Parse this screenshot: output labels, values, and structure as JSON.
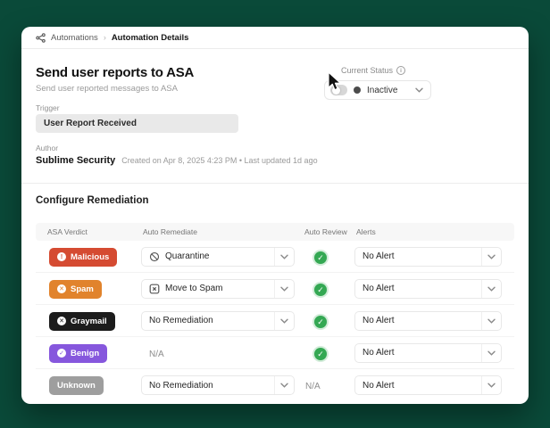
{
  "colors": {
    "malicious": "#d54b32",
    "spam": "#e1832c",
    "graymail": "#1c1c1c",
    "benign": "#8657dd",
    "unknown": "#9e9e9e",
    "check_green": "#34a853",
    "status_dot": "#4c4c4c"
  },
  "breadcrumb": {
    "items": [
      {
        "label": "Automations"
      },
      {
        "label": "Automation Details"
      }
    ]
  },
  "header": {
    "title": "Send user reports to ASA",
    "subtitle": "Send user reported messages to ASA"
  },
  "status": {
    "label": "Current Status",
    "value": "Inactive"
  },
  "trigger": {
    "label": "Trigger",
    "value": "User Report Received"
  },
  "author": {
    "label": "Author",
    "name": "Sublime Security",
    "meta": "Created on Apr 8, 2025 4:23 PM • Last updated 1d ago"
  },
  "remediation": {
    "title": "Configure Remediation",
    "columns": [
      "ASA Verdict",
      "Auto Remediate",
      "Auto Review",
      "Alerts"
    ],
    "na_label": "N/A",
    "rows": [
      {
        "verdict": "Malicious",
        "verdict_color": "#d54b32",
        "verdict_icon": "alert-circle-icon",
        "remediate": "Quarantine",
        "remediate_icon": "block-icon",
        "remediate_dropdown": true,
        "review": "approved",
        "alert": "No Alert"
      },
      {
        "verdict": "Spam",
        "verdict_color": "#e1832c",
        "verdict_icon": "x-circle-icon",
        "remediate": "Move to Spam",
        "remediate_icon": "spam-box-icon",
        "remediate_dropdown": true,
        "review": "approved",
        "alert": "No Alert"
      },
      {
        "verdict": "Graymail",
        "verdict_color": "#1c1c1c",
        "verdict_icon": "x-circle-icon",
        "remediate": "No Remediation",
        "remediate_icon": null,
        "remediate_dropdown": true,
        "review": "approved",
        "alert": "No Alert"
      },
      {
        "verdict": "Benign",
        "verdict_color": "#8657dd",
        "verdict_icon": "check-circle-icon",
        "remediate": "N/A",
        "remediate_icon": null,
        "remediate_dropdown": false,
        "review": "approved",
        "alert": "No Alert"
      },
      {
        "verdict": "Unknown",
        "verdict_color": "#9e9e9e",
        "verdict_icon": null,
        "remediate": "No Remediation",
        "remediate_icon": null,
        "remediate_dropdown": true,
        "review": "N/A",
        "alert": "No Alert"
      }
    ]
  }
}
